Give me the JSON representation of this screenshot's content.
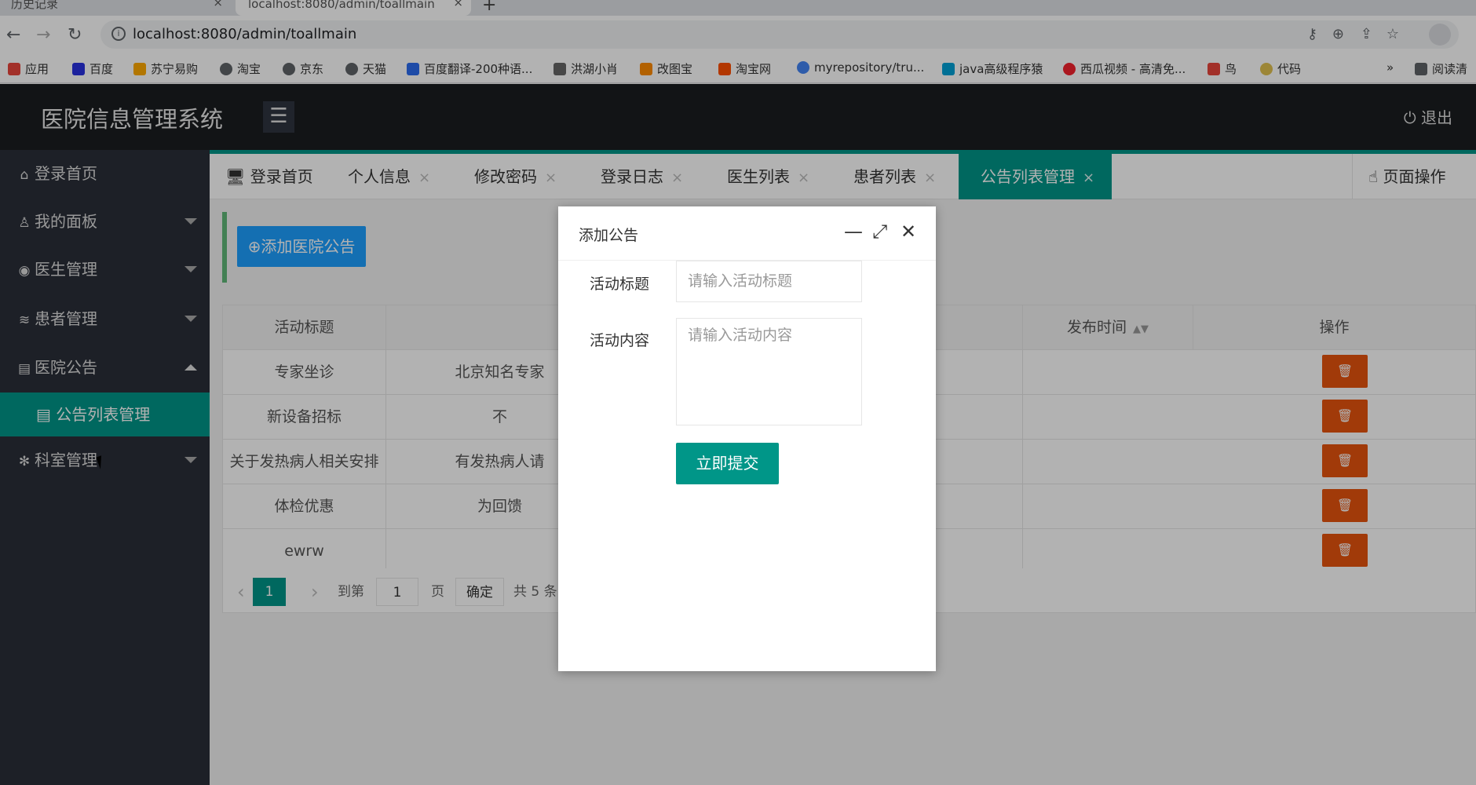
{
  "browser": {
    "tabs": [
      {
        "label": "历史记录"
      },
      {
        "label": "localhost:8080/admin/toallmain"
      }
    ],
    "url": "localhost:8080/admin/toallmain",
    "bookmarks": [
      {
        "label": "应用",
        "color": "#e8453c"
      },
      {
        "label": "百度",
        "color": "#2932e1"
      },
      {
        "label": "苏宁易购",
        "color": "#ffaa00"
      },
      {
        "label": "淘宝",
        "color": "#5f6368"
      },
      {
        "label": "京东",
        "color": "#5f6368"
      },
      {
        "label": "天猫",
        "color": "#5f6368"
      },
      {
        "label": "百度翻译-200种语...",
        "color": "#2b6cf0"
      },
      {
        "label": "洪湖小肖",
        "color": "#666666"
      },
      {
        "label": "改图宝",
        "color": "#ff8c00"
      },
      {
        "label": "淘宝网",
        "color": "#ff5000"
      },
      {
        "label": "myrepository/tru...",
        "color": "#4285f4"
      },
      {
        "label": "java高级程序猿",
        "color": "#00a1d6"
      },
      {
        "label": "西瓜视频 - 高清免...",
        "color": "#f5222d"
      },
      {
        "label": "鸟",
        "color": "#e8453c"
      },
      {
        "label": "代码",
        "color": "#e0c050"
      },
      {
        "label": "阅读清",
        "color": "#5f6368"
      }
    ],
    "overflow": "»"
  },
  "header": {
    "title": "医院信息管理系统",
    "menu_icon": "☰",
    "logout": "退出"
  },
  "sidebar": {
    "items": [
      {
        "label": "登录首页",
        "icon": "⌂"
      },
      {
        "label": "我的面板",
        "icon": "♙"
      },
      {
        "label": "医生管理",
        "icon": "◉"
      },
      {
        "label": "患者管理",
        "icon": "≋"
      },
      {
        "label": "医院公告",
        "icon": "▤"
      },
      {
        "label": "科室管理",
        "icon": "✻"
      }
    ],
    "sub_item": {
      "label": "公告列表管理",
      "icon": "▤"
    }
  },
  "tabs": {
    "items": [
      {
        "label": "登录首页"
      },
      {
        "label": "个人信息"
      },
      {
        "label": "修改密码"
      },
      {
        "label": "登录日志"
      },
      {
        "label": "医生列表"
      },
      {
        "label": "患者列表"
      },
      {
        "label": "公告列表管理"
      }
    ],
    "close": "×",
    "page_ops": "页面操作"
  },
  "content": {
    "add_button": "添加医院公告",
    "table": {
      "headers": [
        "活动标题",
        "发布时间",
        "操作"
      ],
      "rows": [
        {
          "title": "专家坐诊",
          "content": "北京知名专家"
        },
        {
          "title": "新设备招标",
          "content": "不"
        },
        {
          "title": "关于发热病人相关安排",
          "content": "有发热病人请"
        },
        {
          "title": "体检优惠",
          "content": "为回馈"
        },
        {
          "title": "ewrw",
          "content": ""
        }
      ]
    },
    "pager": {
      "prev": "‹",
      "current": "1",
      "next": "›",
      "goto": "到第",
      "page_input": "1",
      "page_unit": "页",
      "confirm": "确定",
      "total": "共 5 条"
    }
  },
  "modal": {
    "title": "添加公告",
    "minimize": "—",
    "maximize": "⤢",
    "close": "✕",
    "title_label": "活动标题",
    "title_placeholder": "请输入活动标题",
    "content_label": "活动内容",
    "content_placeholder": "请输入活动内容",
    "submit": "立即提交"
  }
}
